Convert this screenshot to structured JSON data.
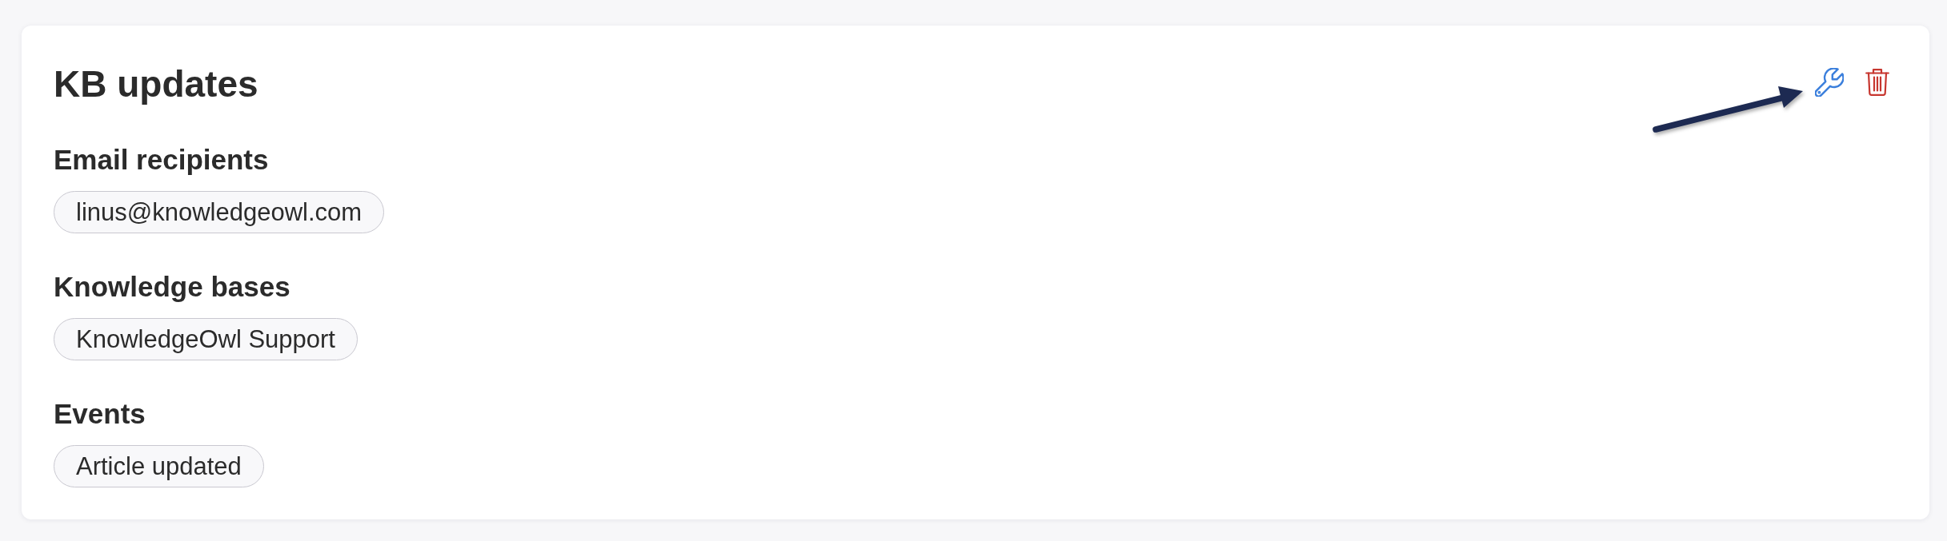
{
  "card": {
    "title": "KB updates",
    "actions": [
      {
        "kind": "edit"
      },
      {
        "kind": "delete"
      }
    ],
    "sections": [
      {
        "heading": "Email recipients",
        "tags": [
          "linus@knowledgeowl.com"
        ]
      },
      {
        "heading": "Knowledge bases",
        "tags": [
          "KnowledgeOwl Support"
        ]
      },
      {
        "heading": "Events",
        "tags": [
          "Article updated"
        ]
      }
    ],
    "annotations": [
      {
        "kind": "arrow"
      }
    ]
  }
}
